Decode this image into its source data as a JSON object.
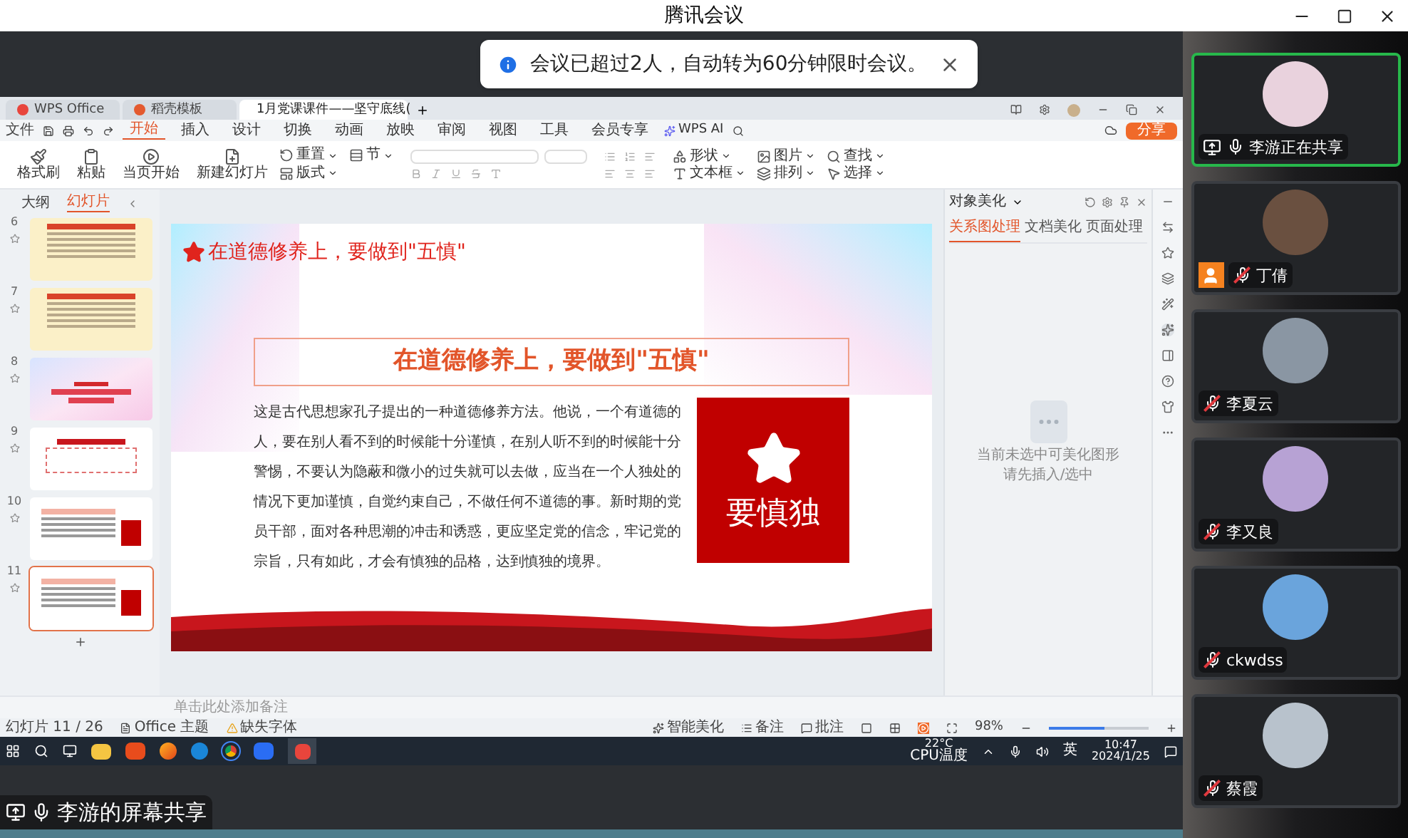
{
  "window": {
    "title": "腾讯会议"
  },
  "notice": {
    "text": "会议已超过2人，自动转为60分钟限时会议。"
  },
  "shared_screen": {
    "app_tabs": [
      {
        "label": "WPS Office",
        "selected": false
      },
      {
        "label": "稻壳模板",
        "selected": false
      },
      {
        "label": "1月党课课件——坚守底线(",
        "selected": true
      }
    ],
    "menu": {
      "file": "文件",
      "tabs": [
        {
          "label": "开始",
          "selected": true
        },
        {
          "label": "插入",
          "selected": false
        },
        {
          "label": "设计",
          "selected": false
        },
        {
          "label": "切换",
          "selected": false
        },
        {
          "label": "动画",
          "selected": false
        },
        {
          "label": "放映",
          "selected": false
        },
        {
          "label": "审阅",
          "selected": false
        },
        {
          "label": "视图",
          "selected": false
        },
        {
          "label": "工具",
          "selected": false
        },
        {
          "label": "会员专享",
          "selected": false
        }
      ],
      "ai": "WPS AI",
      "share": "分享"
    },
    "ribbon_left": [
      {
        "label": "格式刷",
        "kind": "large"
      },
      {
        "label": "粘贴",
        "kind": "large"
      },
      {
        "label": "当页开始",
        "kind": "large"
      },
      {
        "label": "新建幻灯片",
        "kind": "large"
      },
      {
        "label": "重置",
        "kind": "small"
      },
      {
        "label": "版式",
        "kind": "small"
      },
      {
        "label": "节",
        "kind": "small"
      }
    ],
    "ribbon_right": [
      {
        "label": "形状",
        "kind": "small"
      },
      {
        "label": "文本框",
        "kind": "small"
      },
      {
        "label": "图片",
        "kind": "small"
      },
      {
        "label": "排列",
        "kind": "small"
      },
      {
        "label": "查找",
        "kind": "small"
      },
      {
        "label": "选择",
        "kind": "small"
      }
    ],
    "panel_tabs": [
      {
        "label": "大纲",
        "selected": false
      },
      {
        "label": "幻灯片",
        "selected": true
      }
    ],
    "thumbnails": [
      {
        "number": "6",
        "kind": "notice",
        "selected": false
      },
      {
        "number": "7",
        "kind": "notice",
        "selected": false
      },
      {
        "number": "8",
        "kind": "section",
        "selected": false
      },
      {
        "number": "9",
        "kind": "content",
        "selected": false
      },
      {
        "number": "10",
        "kind": "star",
        "selected": false
      },
      {
        "number": "11",
        "kind": "star",
        "selected": true
      }
    ],
    "slide": {
      "header": "在道德修养上，要做到\"五慎\"",
      "title": "在道德修养上，要做到\"五慎\"",
      "body": "这是古代思想家孔子提出的一种道德修养方法。他说，一个有道德的人，要在别人看不到的时候能十分谨慎，在别人听不到的时候能十分警惕，不要认为隐蔽和微小的过失就可以去做，应当在一个人独处的情况下更加谨慎，自觉约束自己，不做任何不道德的事。新时期的党员干部，面对各种思潮的冲击和诱惑，更应坚定党的信念，牢记党的宗旨，只有如此，才会有慎独的品格，达到慎独的境界。",
      "badge": "要慎独"
    },
    "side_panel": {
      "title": "对象美化",
      "tabs": [
        {
          "label": "关系图处理",
          "selected": true
        },
        {
          "label": "文档美化",
          "selected": false
        },
        {
          "label": "页面处理",
          "selected": false
        }
      ],
      "empty_text": [
        "当前未选中可美化图形",
        "请先插入/选中"
      ]
    },
    "notes_placeholder": "单击此处添加备注",
    "status_bar": {
      "slide": "幻灯片 11 / 26",
      "theme": "Office 主题",
      "missing_font": "缺失字体",
      "beautify": "智能美化",
      "notes": "备注",
      "comments": "批注",
      "zoom": "98%",
      "zoom_slider": {
        "level": 0.55
      }
    },
    "taskbar": {
      "temperature": "22°C",
      "sensor": "CPU温度",
      "ime": "英",
      "time": "10:47",
      "date": "2024/1/25"
    }
  },
  "sharer_badge": "李游的屏幕共享",
  "participants": [
    {
      "name": "李游正在共享",
      "muted": false,
      "sharing": true,
      "active": true,
      "host": false
    },
    {
      "name": "丁倩",
      "muted": true,
      "sharing": false,
      "active": false,
      "host": true
    },
    {
      "name": "李夏云",
      "muted": true,
      "sharing": false,
      "active": false,
      "host": false
    },
    {
      "name": "李又良",
      "muted": true,
      "sharing": false,
      "active": false,
      "host": false
    },
    {
      "name": "ckwdss",
      "muted": true,
      "sharing": false,
      "active": false,
      "host": false
    },
    {
      "name": "蔡霞",
      "muted": true,
      "sharing": false,
      "active": false,
      "host": false
    }
  ]
}
